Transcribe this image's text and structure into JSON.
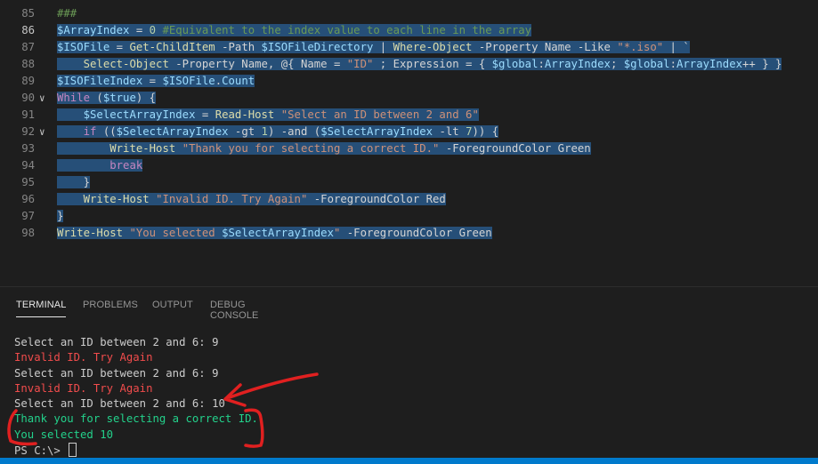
{
  "editor": {
    "lines": [
      {
        "num": "85",
        "text": "###"
      },
      {
        "num": "86",
        "text": "$ArrayIndex = 0 #Equivalent to the index value to each line in the array"
      },
      {
        "num": "87",
        "text": "$ISOFile = Get-ChildItem -Path $ISOFileDirectory | Where-Object -Property Name -Like \"*.iso\" | `"
      },
      {
        "num": "88",
        "text": "    Select-Object -Property Name, @{ Name = \"ID\" ; Expression = { $global:ArrayIndex; $global:ArrayIndex++ } }"
      },
      {
        "num": "89",
        "text": "$ISOFileIndex = $ISOFile.Count"
      },
      {
        "num": "90",
        "text": "While ($true) {"
      },
      {
        "num": "91",
        "text": "    $SelectArrayIndex = Read-Host \"Select an ID between 2 and 6\""
      },
      {
        "num": "92",
        "text": "    if (($SelectArrayIndex -gt 1) -and ($SelectArrayIndex -lt 7)) {"
      },
      {
        "num": "93",
        "text": "        Write-Host \"Thank you for selecting a correct ID.\" -ForegroundColor Green"
      },
      {
        "num": "94",
        "text": "        break"
      },
      {
        "num": "95",
        "text": "    }"
      },
      {
        "num": "96",
        "text": "    Write-Host \"Invalid ID. Try Again\" -ForegroundColor Red"
      },
      {
        "num": "97",
        "text": "}"
      },
      {
        "num": "98",
        "text": "Write-Host \"You selected $SelectArrayIndex\" -ForegroundColor Green"
      }
    ],
    "fold_icon": "chevron-down-icon"
  },
  "panel": {
    "tabs": [
      "TERMINAL",
      "PROBLEMS",
      "OUTPUT",
      "DEBUG CONSOLE"
    ],
    "active_tab": "TERMINAL"
  },
  "terminal": {
    "lines": [
      {
        "text": "Select an ID between 2 and 6: 9",
        "color": "#cccccc"
      },
      {
        "text": "Invalid ID. Try Again",
        "color": "#f14c4c"
      },
      {
        "text": "Select an ID between 2 and 6: 9",
        "color": "#cccccc"
      },
      {
        "text": "Invalid ID. Try Again",
        "color": "#f14c4c"
      },
      {
        "text": "Select an ID between 2 and 6: 10",
        "color": "#cccccc"
      },
      {
        "text": "Thank you for selecting a correct ID.",
        "color": "#23d18b"
      },
      {
        "text": "You selected 10",
        "color": "#23d18b"
      }
    ],
    "prompt": "PS C:\\> "
  },
  "colors": {
    "annotation": "#e02020",
    "statusbar": "#007acc",
    "selection": "#264f78"
  }
}
